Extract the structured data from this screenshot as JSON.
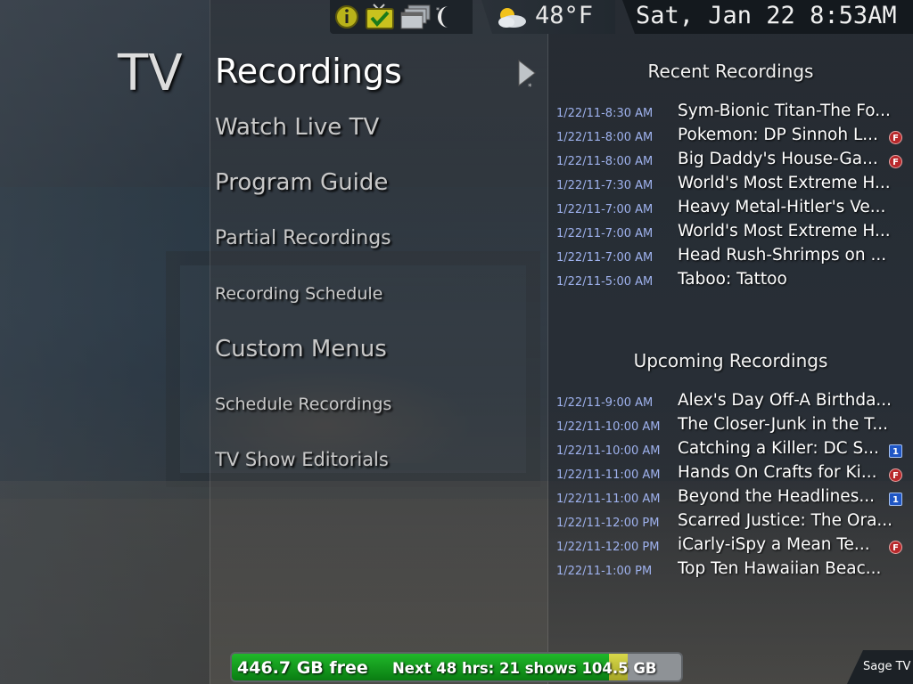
{
  "header": {
    "section": "TV",
    "title": "Recordings",
    "temperature": "48°F",
    "clock": "Sat, Jan 22 8:53AM",
    "icons": [
      "info-icon",
      "tv-check-icon",
      "windows-icon",
      "moon-sleep-icon",
      "weather-partly-cloudy-icon"
    ]
  },
  "menu": {
    "items": [
      {
        "label": "Watch Live TV"
      },
      {
        "label": "Program Guide"
      },
      {
        "label": "Partial Recordings"
      },
      {
        "label": "Recording Schedule"
      },
      {
        "label": "Custom Menus"
      },
      {
        "label": "Schedule Recordings"
      },
      {
        "label": "TV Show Editorials"
      }
    ]
  },
  "recent": {
    "title": "Recent Recordings",
    "items": [
      {
        "time": "1/22/11-8:30 AM",
        "title": "Sym-Bionic Titan-The Fo...",
        "badge": ""
      },
      {
        "time": "1/22/11-8:00 AM",
        "title": "Pokemon: DP Sinnoh L...",
        "badge": "F"
      },
      {
        "time": "1/22/11-8:00 AM",
        "title": "Big Daddy's House-Ga...",
        "badge": "F"
      },
      {
        "time": "1/22/11-7:30 AM",
        "title": "World's Most Extreme H...",
        "badge": ""
      },
      {
        "time": "1/22/11-7:00 AM",
        "title": "Heavy Metal-Hitler's Ve...",
        "badge": ""
      },
      {
        "time": "1/22/11-7:00 AM",
        "title": "World's Most Extreme H...",
        "badge": ""
      },
      {
        "time": "1/22/11-7:00 AM",
        "title": "Head Rush-Shrimps on ...",
        "badge": ""
      },
      {
        "time": "1/22/11-5:00 AM",
        "title": "Taboo: Tattoo",
        "badge": ""
      }
    ]
  },
  "upcoming": {
    "title": "Upcoming Recordings",
    "items": [
      {
        "time": "1/22/11-9:00 AM",
        "title": "Alex's Day Off-A Birthda...",
        "badge": ""
      },
      {
        "time": "1/22/11-10:00 AM",
        "title": "The Closer-Junk in the T...",
        "badge": ""
      },
      {
        "time": "1/22/11-10:00 AM",
        "title": "Catching a Killer: DC S...",
        "badge": "1"
      },
      {
        "time": "1/22/11-11:00 AM",
        "title": "Hands On Crafts for Ki...",
        "badge": "F"
      },
      {
        "time": "1/22/11-11:00 AM",
        "title": "Beyond the Headlines...",
        "badge": "1"
      },
      {
        "time": "1/22/11-12:00 PM",
        "title": "Scarred Justice: The Ora...",
        "badge": ""
      },
      {
        "time": "1/22/11-12:00 PM",
        "title": "iCarly-iSpy a Mean Te...",
        "badge": "F"
      },
      {
        "time": "1/22/11-1:00 PM",
        "title": "Top Ten Hawaiian Beac...",
        "badge": ""
      }
    ]
  },
  "footer": {
    "free": "446.7 GB free",
    "next": "Next 48 hrs: 21 shows 104.5 GB",
    "used_fraction": 0.84,
    "next_fraction": 0.04
  },
  "logo": "Sage TV",
  "colors": {
    "time": "#9fb2ee",
    "badge_red": "#b8282b",
    "badge_blue": "#1f56c4",
    "bar_green": "#20b82a"
  }
}
